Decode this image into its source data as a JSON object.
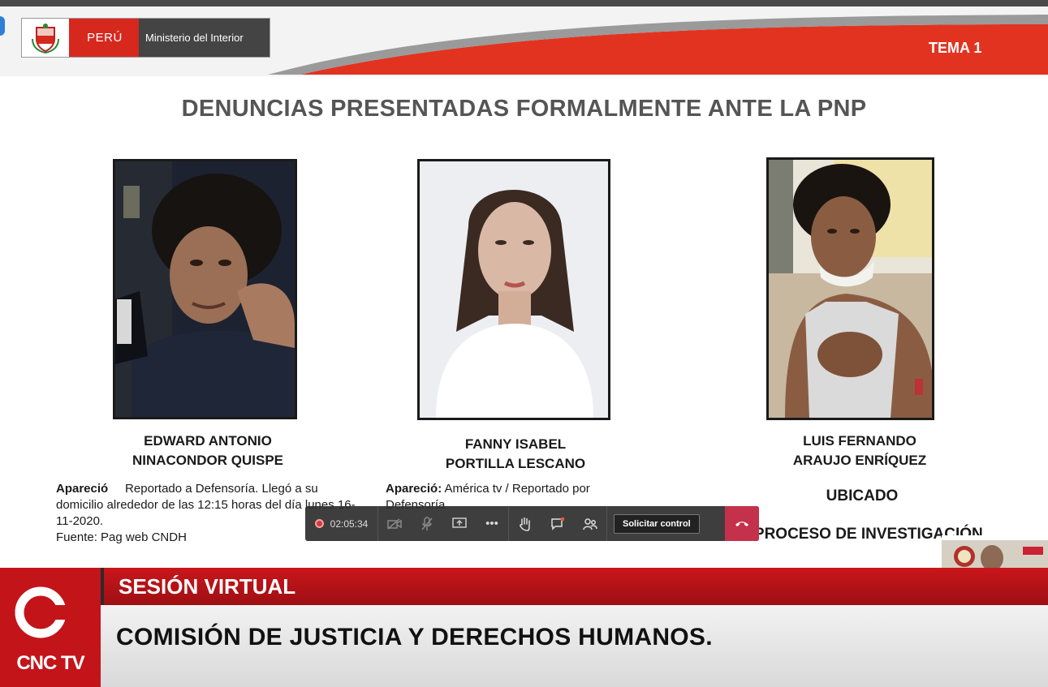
{
  "header": {
    "logo_country": "PERÚ",
    "logo_ministry": "Ministerio del Interior",
    "topic": "TEMA 1"
  },
  "slide": {
    "title": "DENUNCIAS PRESENTADAS FORMALMENTE ANTE LA PNP",
    "persons": [
      {
        "name_line1": "EDWARD ANTONIO",
        "name_line2": "NINACONDOR QUISPE",
        "desc_label": "Apareció",
        "desc_text": "Reportado a Defensoría. Llegó a su domicilio alrededor de las 12:15 horas del día lunes 16-11-2020.",
        "source": "Fuente: Pag web CNDH"
      },
      {
        "name_line1": "FANNY ISABEL",
        "name_line2": "PORTILLA LESCANO",
        "desc_label": "Apareció:",
        "desc_text": "América tv  / Reportado por Defensoría"
      },
      {
        "name_line1": "LUIS FERNANDO",
        "name_line2": "ARAUJO ENRÍQUEZ",
        "status1": "UBICADO",
        "status2": "EN PROCESO DE INVESTIGACIÓN"
      }
    ]
  },
  "toolbar": {
    "recording_time": "02:05:34",
    "request_control_label": "Solicitar control",
    "icons": [
      "camera-off-icon",
      "mic-off-icon",
      "share-screen-icon",
      "more-icon",
      "raise-hand-icon",
      "chat-icon",
      "participants-icon",
      "hang-up-icon"
    ]
  },
  "lower_third": {
    "session_label": "SESIÓN VIRTUAL",
    "commission": "COMISIÓN DE JUSTICIA Y DERECHOS HUMANOS.",
    "channel": "CNC TV"
  },
  "colors": {
    "brand_red": "#c9161b",
    "hangup_red": "#c4314b",
    "title_gray": "#555555"
  }
}
